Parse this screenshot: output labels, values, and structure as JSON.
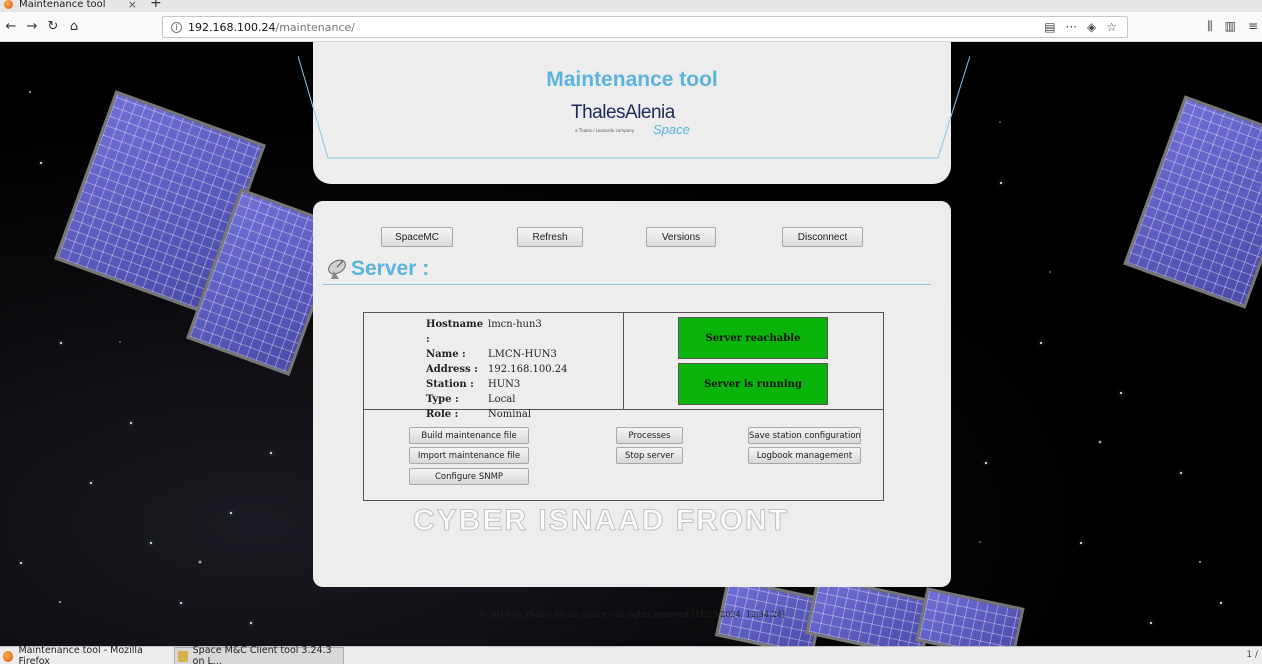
{
  "browser": {
    "tab_title": "Maintenance tool",
    "tab_close": "×",
    "new_tab": "+",
    "url_host": "192.168.100.24",
    "url_path": "/maintenance/",
    "back": "←",
    "forward": "→",
    "reload": "↻",
    "home": "⌂",
    "more": "···"
  },
  "header": {
    "title": "Maintenance tool",
    "logo_main": "ThalesAlenia",
    "logo_sub": "Space",
    "logo_tag": "a Thales / Leonardo company"
  },
  "toolbar": {
    "spacemc": "SpaceMC",
    "refresh": "Refresh",
    "versions": "Versions",
    "disconnect": "Disconnect"
  },
  "server": {
    "heading": "Server :",
    "fields": [
      {
        "key": "Hostname :",
        "value": "lmcn-hun3"
      },
      {
        "key": "Name :",
        "value": "LMCN-HUN3"
      },
      {
        "key": "Address :",
        "value": "192.168.100.24"
      },
      {
        "key": "Station :",
        "value": "HUN3"
      },
      {
        "key": "Type :",
        "value": "Local"
      },
      {
        "key": "Role :",
        "value": "Nominal"
      }
    ],
    "status_reachable": "Server reachable",
    "status_running": "Server is running"
  },
  "commands": {
    "build": "Build maintenance file",
    "import": "Import maintenance file",
    "snmp": "Configure SNMP",
    "processes": "Processes",
    "stop": "Stop server",
    "save_station": "Save station configuration",
    "logbook": "Logbook management"
  },
  "footer": "© 2018 by Thales Alenia Space - all rights reserved [11/25/2024; 12:34:24]",
  "watermark": "CYBER ISNAAD FRONT",
  "taskbar": {
    "task1": "Maintenance tool - Mozilla Firefox",
    "task2": "Space M&C Client tool 3.24.3 on L...",
    "pager": "1 /"
  },
  "colors": {
    "accent": "#5bb3e0",
    "status_green": "#0ab40a",
    "panel": "#ededed"
  }
}
